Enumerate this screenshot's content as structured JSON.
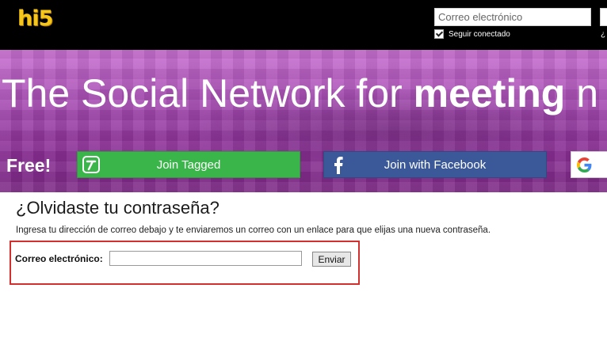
{
  "header": {
    "logo_text": "hi5",
    "email_placeholder": "Correo electrónico",
    "remember_label": "Seguir conectado",
    "remember_checked": true,
    "forgot_short": "¿"
  },
  "hero": {
    "headline_plain": "The Social Network for ",
    "headline_bold": "meeting",
    "headline_tail": " n",
    "free_label": "Free!",
    "join_tagged_label": "Join Tagged",
    "join_facebook_label": "Join with Facebook"
  },
  "forgot": {
    "title": "¿Olvidaste tu contraseña?",
    "description": "Ingresa tu dirección de correo debajo y te enviaremos un correo con un enlace para que elijas una nueva contraseña.",
    "email_label": "Correo electrónico:",
    "email_value": "",
    "submit_label": "Enviar"
  },
  "colors": {
    "logo": "#f6c61b",
    "tagged_green": "#3ab549",
    "facebook_blue": "#3b5998",
    "highlight_red": "#d22f2f",
    "hero_purple": "#a34aaf"
  }
}
